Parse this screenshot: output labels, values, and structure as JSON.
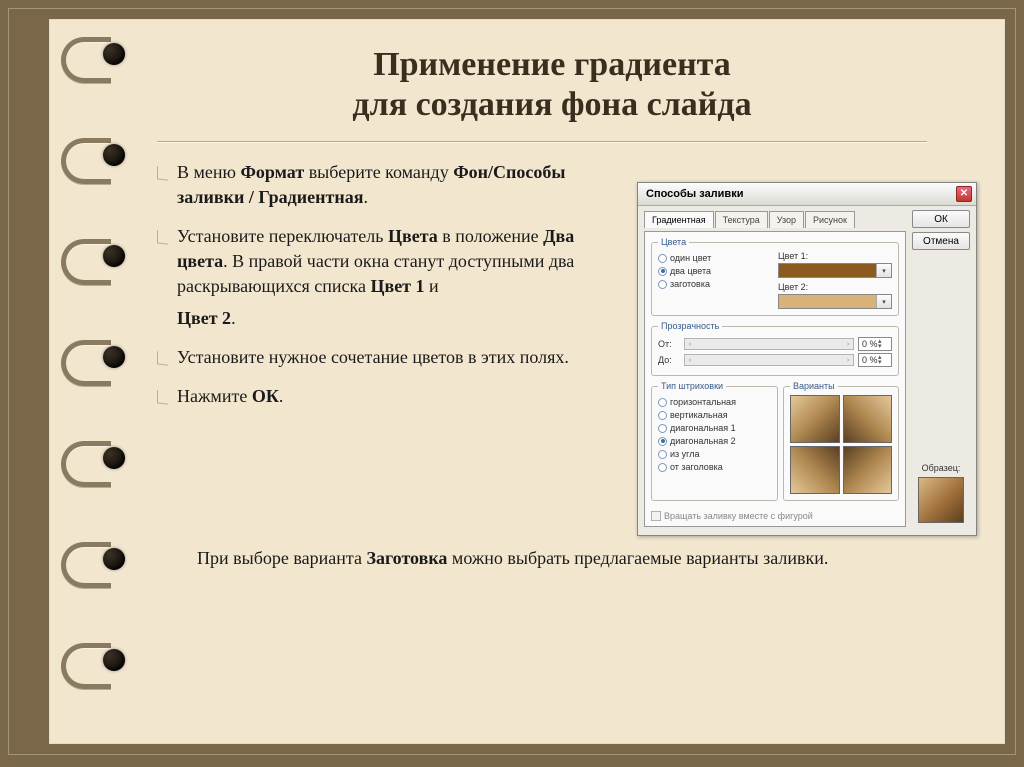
{
  "title_line1": "Применение градиента",
  "title_line2": "для создания фона слайда",
  "bullets": {
    "b1_a": "В меню ",
    "b1_b1": "Формат",
    "b1_c": " выберите команду ",
    "b1_b2": "Фон/Способы заливки / Градиентная",
    "b1_d": ".",
    "b2_a": "Установите переключатель ",
    "b2_b1": "Цвета",
    "b2_c": " в положение ",
    "b2_b2": "Два цвета",
    "b2_d": ". В правой части окна станут доступными два раскрывающихся списка ",
    "b2_b3": "Цвет 1",
    "b2_e": " и",
    "b2_b4": "Цвет 2",
    "b2_f": ".",
    "b3": "Установите нужное сочетание цветов в этих полях.",
    "b4_a": "Нажмите ",
    "b4_b": "ОК",
    "b4_c": "."
  },
  "footer": {
    "a": "При выборе варианта ",
    "b": "Заготовка",
    "c": " можно выбрать предлагаемые варианты заливки."
  },
  "dialog": {
    "title": "Способы заливки",
    "tabs": [
      "Градиентная",
      "Текстура",
      "Узор",
      "Рисунок"
    ],
    "buttons": {
      "ok": "ОК",
      "cancel": "Отмена"
    },
    "groups": {
      "colors": "Цвета",
      "transparency": "Прозрачность",
      "shading": "Тип штриховки",
      "variants": "Варианты"
    },
    "radios": {
      "one": "один цвет",
      "two": "два цвета",
      "preset": "заготовка"
    },
    "color1_label": "Цвет 1:",
    "color2_label": "Цвет 2:",
    "color1": "#8a5a1e",
    "color2": "#d8b279",
    "trans_from": "От:",
    "trans_to": "До:",
    "trans_value": "0 %",
    "shadings": [
      "горизонтальная",
      "вертикальная",
      "диагональная 1",
      "диагональная 2",
      "из угла",
      "от заголовка"
    ],
    "shading_selected_index": 3,
    "rotate_label": "Вращать заливку вместе с фигурой",
    "sample_label": "Образец:"
  }
}
